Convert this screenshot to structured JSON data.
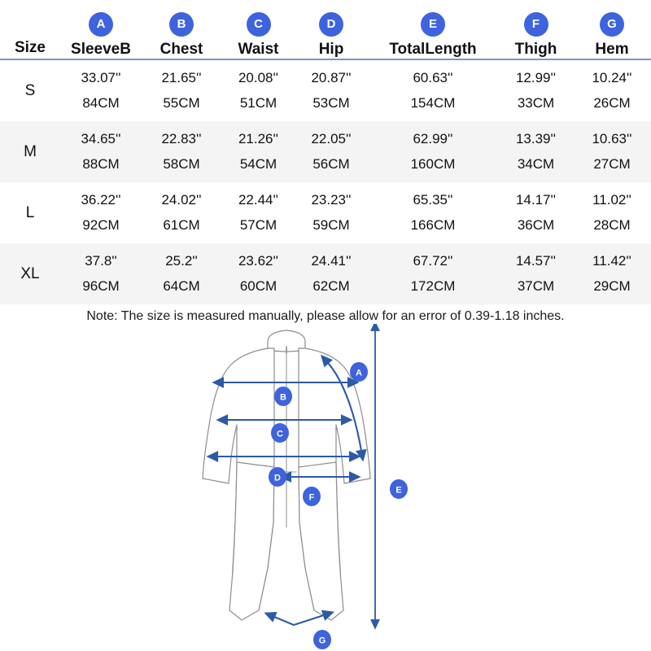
{
  "table": {
    "size_header": "Size",
    "columns": [
      {
        "badge": "A",
        "label": "SleeveB"
      },
      {
        "badge": "B",
        "label": "Chest"
      },
      {
        "badge": "C",
        "label": "Waist"
      },
      {
        "badge": "D",
        "label": "Hip"
      },
      {
        "badge": "E",
        "label": "TotalLength"
      },
      {
        "badge": "F",
        "label": "Thigh"
      },
      {
        "badge": "G",
        "label": "Hem"
      }
    ],
    "rows": [
      {
        "size": "S",
        "inches": [
          "33.07''",
          "21.65''",
          "20.08''",
          "20.87''",
          "60.63''",
          "12.99''",
          "10.24''"
        ],
        "cm": [
          "84CM",
          "55CM",
          "51CM",
          "53CM",
          "154CM",
          "33CM",
          "26CM"
        ]
      },
      {
        "size": "M",
        "inches": [
          "34.65''",
          "22.83''",
          "21.26''",
          "22.05''",
          "62.99''",
          "13.39''",
          "10.63''"
        ],
        "cm": [
          "88CM",
          "58CM",
          "54CM",
          "56CM",
          "160CM",
          "34CM",
          "27CM"
        ]
      },
      {
        "size": "L",
        "inches": [
          "36.22''",
          "24.02''",
          "22.44''",
          "23.23''",
          "65.35''",
          "14.17''",
          "11.02''"
        ],
        "cm": [
          "92CM",
          "61CM",
          "57CM",
          "59CM",
          "166CM",
          "36CM",
          "28CM"
        ]
      },
      {
        "size": "XL",
        "inches": [
          "37.8''",
          "25.2''",
          "23.62''",
          "24.41''",
          "67.72''",
          "14.57''",
          "11.42''"
        ],
        "cm": [
          "96CM",
          "64CM",
          "60CM",
          "62CM",
          "172CM",
          "37CM",
          "29CM"
        ]
      }
    ]
  },
  "note": "Note: The size is measured manually, please allow for an error of 0.39-1.18 inches.",
  "diagram": {
    "garment": "jumpsuit-coverall-front-view",
    "markers": [
      {
        "badge": "A",
        "measure": "sleeve-length"
      },
      {
        "badge": "B",
        "measure": "chest-width"
      },
      {
        "badge": "C",
        "measure": "waist-width"
      },
      {
        "badge": "D",
        "measure": "hip-width"
      },
      {
        "badge": "E",
        "measure": "total-length"
      },
      {
        "badge": "F",
        "measure": "thigh-width"
      },
      {
        "badge": "G",
        "measure": "hem-width"
      }
    ]
  },
  "colors": {
    "badge_blue": "#3e63dd",
    "arrow_blue": "#2c5aa8",
    "row_alt": "#f4f4f4",
    "header_rule": "#7f96bd",
    "outline_gray": "#8a8a8a"
  }
}
